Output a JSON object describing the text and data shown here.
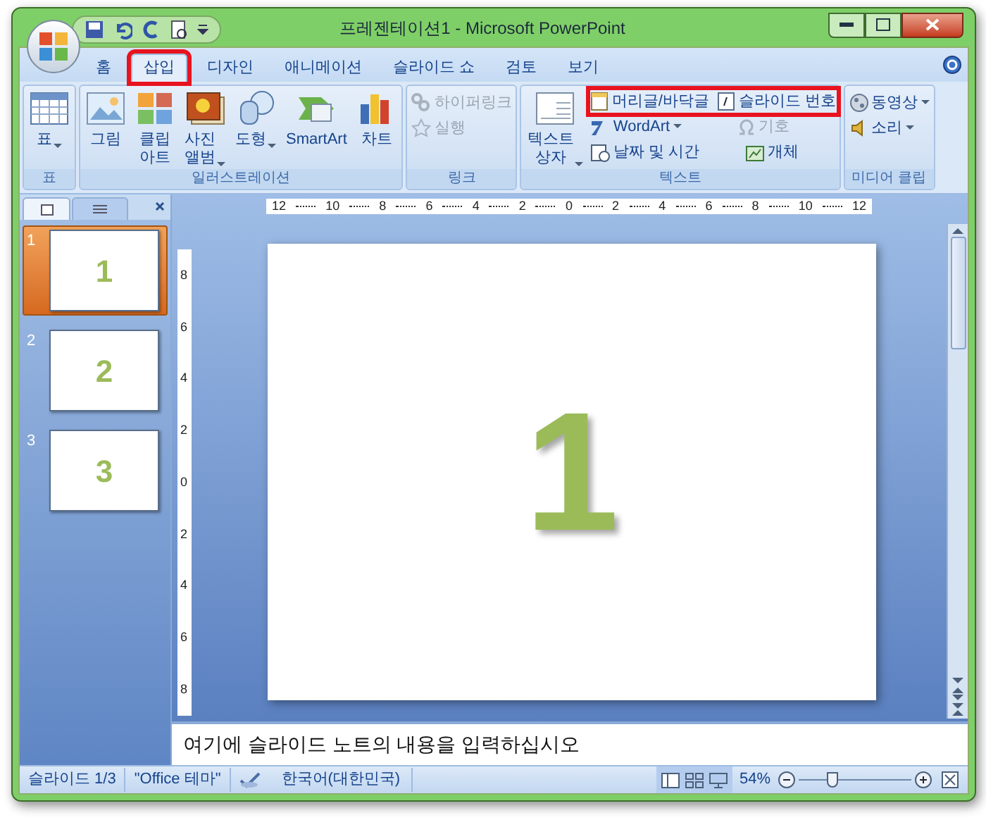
{
  "window": {
    "title": "프레젠테이션1 - Microsoft PowerPoint"
  },
  "tabs": [
    {
      "label": "홈",
      "selected": false,
      "highlighted": false
    },
    {
      "label": "삽입",
      "selected": true,
      "highlighted": true
    },
    {
      "label": "디자인",
      "selected": false,
      "highlighted": false
    },
    {
      "label": "애니메이션",
      "selected": false,
      "highlighted": false
    },
    {
      "label": "슬라이드 쇼",
      "selected": false,
      "highlighted": false
    },
    {
      "label": "검토",
      "selected": false,
      "highlighted": false
    },
    {
      "label": "보기",
      "selected": false,
      "highlighted": false
    }
  ],
  "ribbon": {
    "groups": [
      {
        "label": "표",
        "large": [
          {
            "label": "표",
            "caret": true,
            "disabled": false
          }
        ]
      },
      {
        "label": "일러스트레이션",
        "large": [
          {
            "label": "그림",
            "caret": false,
            "disabled": false
          },
          {
            "label": "클립\n아트",
            "caret": false,
            "disabled": false
          },
          {
            "label": "사진\n앨범",
            "caret": true,
            "disabled": false
          },
          {
            "label": "도형",
            "caret": true,
            "disabled": false
          },
          {
            "label": "SmartArt",
            "caret": false,
            "disabled": false
          },
          {
            "label": "차트",
            "caret": false,
            "disabled": false
          }
        ]
      },
      {
        "label": "링크",
        "small": [
          {
            "label": "하이퍼링크",
            "caret": false,
            "disabled": true
          },
          {
            "label": "실행",
            "caret": false,
            "disabled": true
          }
        ]
      },
      {
        "label": "텍스트",
        "large": [
          {
            "label": "텍스트\n상자",
            "caret": true,
            "disabled": false
          }
        ],
        "rows": [
          {
            "highlighted": true,
            "items": [
              {
                "label": "머리글/바닥글",
                "caret": false,
                "disabled": false
              },
              {
                "label": "슬라이드 번호",
                "caret": false,
                "disabled": false
              }
            ]
          },
          {
            "highlighted": false,
            "items": [
              {
                "label": "WordArt",
                "caret": true,
                "disabled": false
              },
              {
                "label": "기호",
                "caret": false,
                "disabled": true
              }
            ]
          },
          {
            "highlighted": false,
            "items": [
              {
                "label": "날짜 및 시간",
                "caret": false,
                "disabled": false
              },
              {
                "label": "개체",
                "caret": false,
                "disabled": false
              }
            ]
          }
        ]
      },
      {
        "label": "미디어 클립",
        "small": [
          {
            "label": "동영상",
            "caret": true,
            "disabled": false
          },
          {
            "label": "소리",
            "caret": true,
            "disabled": false
          }
        ]
      }
    ]
  },
  "slides": [
    {
      "number": "1",
      "label": "1",
      "selected": true
    },
    {
      "number": "2",
      "label": "2",
      "selected": false
    },
    {
      "number": "3",
      "label": "3",
      "selected": false
    }
  ],
  "rulers": {
    "horizontal": [
      "12",
      "10",
      "8",
      "6",
      "4",
      "2",
      "0",
      "2",
      "4",
      "6",
      "8",
      "10",
      "12"
    ],
    "vertical": [
      "8",
      "6",
      "4",
      "2",
      "0",
      "2",
      "4",
      "6",
      "8"
    ]
  },
  "slide": {
    "text": "1"
  },
  "notes": {
    "placeholder": "여기에 슬라이드 노트의 내용을 입력하십시오"
  },
  "status_bar": {
    "slide": "슬라이드 1/3",
    "theme": "\"Office 테마\"",
    "language": "한국어(대한민국)",
    "zoom": "54%",
    "zoom_slider": {
      "level": 0.3
    }
  }
}
